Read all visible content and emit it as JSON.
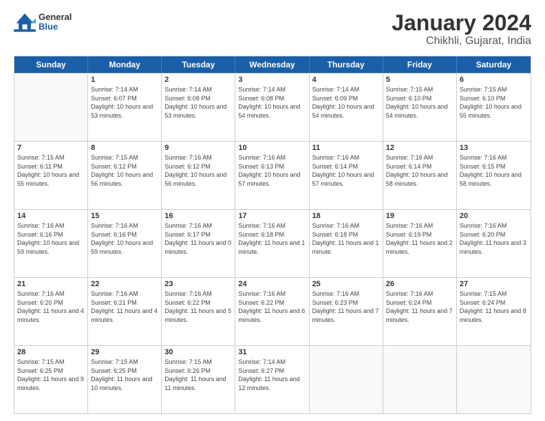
{
  "header": {
    "logo": {
      "general": "General",
      "blue": "Blue"
    },
    "title": "January 2024",
    "subtitle": "Chikhli, Gujarat, India"
  },
  "weekdays": [
    "Sunday",
    "Monday",
    "Tuesday",
    "Wednesday",
    "Thursday",
    "Friday",
    "Saturday"
  ],
  "rows": [
    [
      {
        "day": "",
        "empty": true
      },
      {
        "day": "1",
        "sunrise": "Sunrise: 7:14 AM",
        "sunset": "Sunset: 6:07 PM",
        "daylight": "Daylight: 10 hours and 53 minutes."
      },
      {
        "day": "2",
        "sunrise": "Sunrise: 7:14 AM",
        "sunset": "Sunset: 6:08 PM",
        "daylight": "Daylight: 10 hours and 53 minutes."
      },
      {
        "day": "3",
        "sunrise": "Sunrise: 7:14 AM",
        "sunset": "Sunset: 6:08 PM",
        "daylight": "Daylight: 10 hours and 54 minutes."
      },
      {
        "day": "4",
        "sunrise": "Sunrise: 7:14 AM",
        "sunset": "Sunset: 6:09 PM",
        "daylight": "Daylight: 10 hours and 54 minutes."
      },
      {
        "day": "5",
        "sunrise": "Sunrise: 7:15 AM",
        "sunset": "Sunset: 6:10 PM",
        "daylight": "Daylight: 10 hours and 54 minutes."
      },
      {
        "day": "6",
        "sunrise": "Sunrise: 7:15 AM",
        "sunset": "Sunset: 6:10 PM",
        "daylight": "Daylight: 10 hours and 55 minutes."
      }
    ],
    [
      {
        "day": "7",
        "sunrise": "Sunrise: 7:15 AM",
        "sunset": "Sunset: 6:11 PM",
        "daylight": "Daylight: 10 hours and 55 minutes."
      },
      {
        "day": "8",
        "sunrise": "Sunrise: 7:15 AM",
        "sunset": "Sunset: 6:12 PM",
        "daylight": "Daylight: 10 hours and 56 minutes."
      },
      {
        "day": "9",
        "sunrise": "Sunrise: 7:16 AM",
        "sunset": "Sunset: 6:12 PM",
        "daylight": "Daylight: 10 hours and 56 minutes."
      },
      {
        "day": "10",
        "sunrise": "Sunrise: 7:16 AM",
        "sunset": "Sunset: 6:13 PM",
        "daylight": "Daylight: 10 hours and 57 minutes."
      },
      {
        "day": "11",
        "sunrise": "Sunrise: 7:16 AM",
        "sunset": "Sunset: 6:14 PM",
        "daylight": "Daylight: 10 hours and 57 minutes."
      },
      {
        "day": "12",
        "sunrise": "Sunrise: 7:16 AM",
        "sunset": "Sunset: 6:14 PM",
        "daylight": "Daylight: 10 hours and 58 minutes."
      },
      {
        "day": "13",
        "sunrise": "Sunrise: 7:16 AM",
        "sunset": "Sunset: 6:15 PM",
        "daylight": "Daylight: 10 hours and 58 minutes."
      }
    ],
    [
      {
        "day": "14",
        "sunrise": "Sunrise: 7:16 AM",
        "sunset": "Sunset: 6:16 PM",
        "daylight": "Daylight: 10 hours and 59 minutes."
      },
      {
        "day": "15",
        "sunrise": "Sunrise: 7:16 AM",
        "sunset": "Sunset: 6:16 PM",
        "daylight": "Daylight: 10 hours and 59 minutes."
      },
      {
        "day": "16",
        "sunrise": "Sunrise: 7:16 AM",
        "sunset": "Sunset: 6:17 PM",
        "daylight": "Daylight: 11 hours and 0 minutes."
      },
      {
        "day": "17",
        "sunrise": "Sunrise: 7:16 AM",
        "sunset": "Sunset: 6:18 PM",
        "daylight": "Daylight: 11 hours and 1 minute."
      },
      {
        "day": "18",
        "sunrise": "Sunrise: 7:16 AM",
        "sunset": "Sunset: 6:18 PM",
        "daylight": "Daylight: 11 hours and 1 minute."
      },
      {
        "day": "19",
        "sunrise": "Sunrise: 7:16 AM",
        "sunset": "Sunset: 6:19 PM",
        "daylight": "Daylight: 11 hours and 2 minutes."
      },
      {
        "day": "20",
        "sunrise": "Sunrise: 7:16 AM",
        "sunset": "Sunset: 6:20 PM",
        "daylight": "Daylight: 11 hours and 3 minutes."
      }
    ],
    [
      {
        "day": "21",
        "sunrise": "Sunrise: 7:16 AM",
        "sunset": "Sunset: 6:20 PM",
        "daylight": "Daylight: 11 hours and 4 minutes."
      },
      {
        "day": "22",
        "sunrise": "Sunrise: 7:16 AM",
        "sunset": "Sunset: 6:21 PM",
        "daylight": "Daylight: 11 hours and 4 minutes."
      },
      {
        "day": "23",
        "sunrise": "Sunrise: 7:16 AM",
        "sunset": "Sunset: 6:22 PM",
        "daylight": "Daylight: 11 hours and 5 minutes."
      },
      {
        "day": "24",
        "sunrise": "Sunrise: 7:16 AM",
        "sunset": "Sunset: 6:22 PM",
        "daylight": "Daylight: 11 hours and 6 minutes."
      },
      {
        "day": "25",
        "sunrise": "Sunrise: 7:16 AM",
        "sunset": "Sunset: 6:23 PM",
        "daylight": "Daylight: 11 hours and 7 minutes."
      },
      {
        "day": "26",
        "sunrise": "Sunrise: 7:16 AM",
        "sunset": "Sunset: 6:24 PM",
        "daylight": "Daylight: 11 hours and 7 minutes."
      },
      {
        "day": "27",
        "sunrise": "Sunrise: 7:15 AM",
        "sunset": "Sunset: 6:24 PM",
        "daylight": "Daylight: 11 hours and 8 minutes."
      }
    ],
    [
      {
        "day": "28",
        "sunrise": "Sunrise: 7:15 AM",
        "sunset": "Sunset: 6:25 PM",
        "daylight": "Daylight: 11 hours and 9 minutes."
      },
      {
        "day": "29",
        "sunrise": "Sunrise: 7:15 AM",
        "sunset": "Sunset: 6:25 PM",
        "daylight": "Daylight: 11 hours and 10 minutes."
      },
      {
        "day": "30",
        "sunrise": "Sunrise: 7:15 AM",
        "sunset": "Sunset: 6:26 PM",
        "daylight": "Daylight: 11 hours and 11 minutes."
      },
      {
        "day": "31",
        "sunrise": "Sunrise: 7:14 AM",
        "sunset": "Sunset: 6:27 PM",
        "daylight": "Daylight: 11 hours and 12 minutes."
      },
      {
        "day": "",
        "empty": true
      },
      {
        "day": "",
        "empty": true
      },
      {
        "day": "",
        "empty": true
      }
    ]
  ]
}
